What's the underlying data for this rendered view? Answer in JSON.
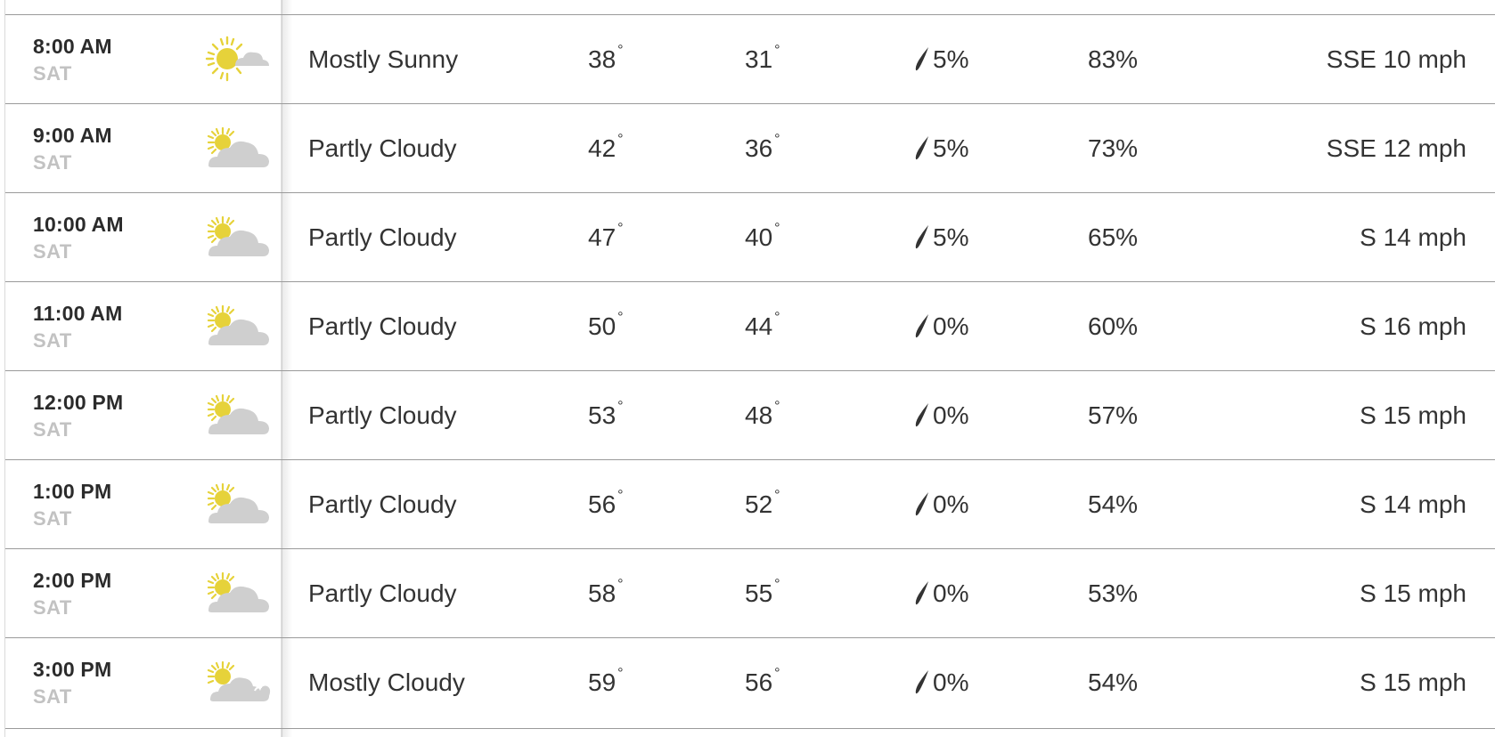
{
  "hourly": {
    "rows": [
      {
        "time": "8:00 AM",
        "day": "SAT",
        "icon": "mostly-sunny-icon",
        "condition": "Mostly Sunny",
        "temp": "38",
        "feels_like": "31",
        "precip": "5%",
        "humidity": "83%",
        "wind": "SSE 10 mph"
      },
      {
        "time": "9:00 AM",
        "day": "SAT",
        "icon": "partly-cloudy-icon",
        "condition": "Partly Cloudy",
        "temp": "42",
        "feels_like": "36",
        "precip": "5%",
        "humidity": "73%",
        "wind": "SSE 12 mph"
      },
      {
        "time": "10:00 AM",
        "day": "SAT",
        "icon": "partly-cloudy-icon",
        "condition": "Partly Cloudy",
        "temp": "47",
        "feels_like": "40",
        "precip": "5%",
        "humidity": "65%",
        "wind": "S 14 mph"
      },
      {
        "time": "11:00 AM",
        "day": "SAT",
        "icon": "partly-cloudy-icon",
        "condition": "Partly Cloudy",
        "temp": "50",
        "feels_like": "44",
        "precip": "0%",
        "humidity": "60%",
        "wind": "S 16 mph"
      },
      {
        "time": "12:00 PM",
        "day": "SAT",
        "icon": "partly-cloudy-icon",
        "condition": "Partly Cloudy",
        "temp": "53",
        "feels_like": "48",
        "precip": "0%",
        "humidity": "57%",
        "wind": "S 15 mph"
      },
      {
        "time": "1:00 PM",
        "day": "SAT",
        "icon": "partly-cloudy-icon",
        "condition": "Partly Cloudy",
        "temp": "56",
        "feels_like": "52",
        "precip": "0%",
        "humidity": "54%",
        "wind": "S 14 mph"
      },
      {
        "time": "2:00 PM",
        "day": "SAT",
        "icon": "partly-cloudy-icon",
        "condition": "Partly Cloudy",
        "temp": "58",
        "feels_like": "55",
        "precip": "0%",
        "humidity": "53%",
        "wind": "S 15 mph"
      },
      {
        "time": "3:00 PM",
        "day": "SAT",
        "icon": "mostly-cloudy-icon",
        "condition": "Mostly Cloudy",
        "temp": "59",
        "feels_like": "56",
        "precip": "0%",
        "humidity": "54%",
        "wind": "S 15 mph"
      }
    ]
  },
  "units": {
    "degree_symbol": "°"
  },
  "colors": {
    "sun": "#e6d23a",
    "cloud": "#cfcfcf",
    "drop": "#333333",
    "day_label": "#c2c2c2",
    "row_divider": "#9a9a9a"
  }
}
